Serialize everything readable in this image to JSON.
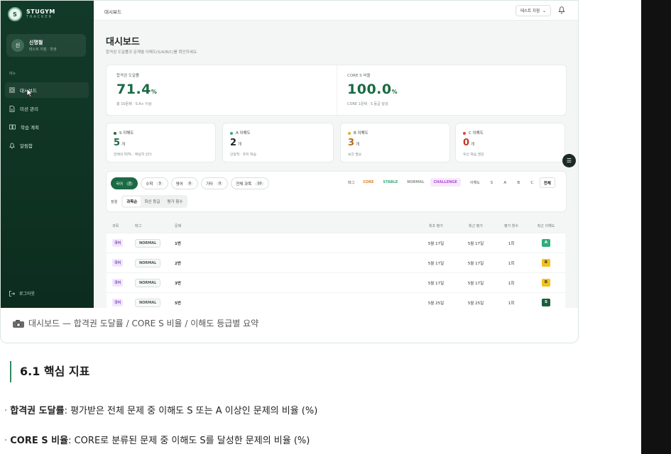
{
  "app": {
    "logo_name": "STUGYM",
    "logo_sub": "TRACKER",
    "logo_mark": "S"
  },
  "user": {
    "avatar": "신",
    "name": "신명철",
    "role": "테스트 지점 · 학생"
  },
  "sidebar": {
    "section_label": "메뉴",
    "items": [
      {
        "label": "대시보드",
        "icon": "grid-icon",
        "active": true
      },
      {
        "label": "미션 관리",
        "icon": "document-icon",
        "active": false
      },
      {
        "label": "학습 계획",
        "icon": "book-icon",
        "active": false
      },
      {
        "label": "알림함",
        "icon": "bell-icon",
        "active": false
      }
    ],
    "logout": "로그아웃"
  },
  "topbar": {
    "title": "대시보드",
    "branch_select": "테스트 지점"
  },
  "page": {
    "title": "대시보드",
    "subtitle": "합격권 도달률과 문제별 이해도(S/A/B/C)를 확인하세요."
  },
  "kpis": [
    {
      "label": "합격권 도달률",
      "value": "71.4",
      "unit": "%",
      "note": "총 10문제 · S·A+ 이상"
    },
    {
      "label": "CORE S 비율",
      "value": "100.0",
      "unit": "%",
      "note": "CORE 1문제 · S 등급 달성"
    }
  ],
  "grades": [
    {
      "label": "S 이해도",
      "value": "5",
      "unit": "개",
      "note": "전체의 50% · 확실히 안다",
      "color": "#1b6a44"
    },
    {
      "label": "A 이해도",
      "value": "2",
      "unit": "개",
      "note": "안정적 · 유지 학습",
      "color": "#2fae77"
    },
    {
      "label": "B 이해도",
      "value": "3",
      "unit": "개",
      "note": "보강 필요",
      "color": "#e3b21a"
    },
    {
      "label": "C 이해도",
      "value": "0",
      "unit": "개",
      "note": "우선 학습 권장",
      "color": "#d6453b"
    }
  ],
  "subject_filters": [
    {
      "label": "국어",
      "count": "7",
      "active": true
    },
    {
      "label": "수학",
      "count": "3",
      "active": false
    },
    {
      "label": "영어",
      "count": "0",
      "active": false
    },
    {
      "label": "기타",
      "count": "0",
      "active": false
    },
    {
      "label": "전체 과목",
      "count": "10",
      "active": false
    }
  ],
  "tag_filter": {
    "label": "태그",
    "tags": [
      {
        "label": "CORE",
        "color": "#e0822a",
        "bg": "#ffffff"
      },
      {
        "label": "STABLE",
        "color": "#3aa77a",
        "bg": "#ffffff"
      },
      {
        "label": "NORMAL",
        "color": "#8a9690",
        "bg": "#ffffff"
      },
      {
        "label": "CHALLENGE",
        "color": "#b04bd6",
        "bg": "#f6e9fb"
      }
    ]
  },
  "grade_filter": {
    "label": "이해도",
    "options": [
      "S",
      "A",
      "B",
      "C",
      "전체"
    ],
    "active": "전체"
  },
  "sort": {
    "label": "정렬",
    "options": [
      "과목순",
      "최신 등급",
      "평가 횟수"
    ],
    "active": "과목순"
  },
  "table": {
    "headers": [
      "과목",
      "태그",
      "문제",
      "최초 평가",
      "최근 평가",
      "평가 횟수",
      "최근 이해도"
    ],
    "rows": [
      {
        "subject": "국어",
        "tag": "NORMAL",
        "problem": "1번",
        "first": "5월 17일",
        "latest": "5월 17일",
        "count": "1회",
        "grade": "A"
      },
      {
        "subject": "국어",
        "tag": "NORMAL",
        "problem": "2번",
        "first": "5월 17일",
        "latest": "5월 17일",
        "count": "1회",
        "grade": "B"
      },
      {
        "subject": "국어",
        "tag": "NORMAL",
        "problem": "3번",
        "first": "5월 17일",
        "latest": "5월 17일",
        "count": "1회",
        "grade": "B"
      },
      {
        "subject": "국어",
        "tag": "NORMAL",
        "problem": "5번",
        "first": "5월 25일",
        "latest": "5월 25일",
        "count": "1회",
        "grade": "S"
      }
    ]
  },
  "grade_colors": {
    "S": "#1b5e3d",
    "A": "#2fae77",
    "B": "#f2c21b",
    "C": "#d6453b"
  },
  "caption": "대시보드 — 합격권 도달률 / CORE S 비율 / 이해도 등급별 요약",
  "doc": {
    "section_title": "6.1 핵심 지표",
    "bullets": [
      {
        "term": "합격권 도달률",
        "desc": ": 평가받은 전체 문제 중 이해도 S 또는 A 이상인 문제의 비율 (%)"
      },
      {
        "term": "CORE S 비율",
        "desc": ": CORE로 분류된 문제 중 이해도 S를 달성한 문제의 비율 (%)"
      }
    ]
  }
}
